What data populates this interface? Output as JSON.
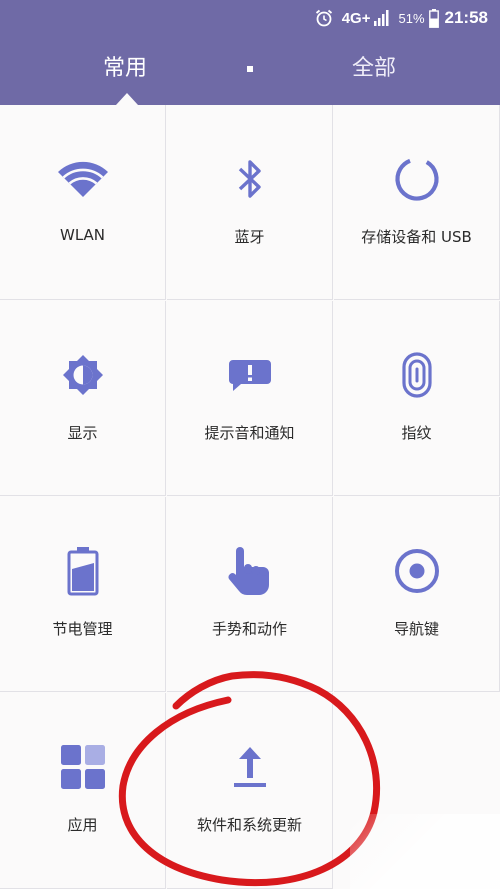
{
  "status_bar": {
    "network": "4G+",
    "battery_percent": "51%",
    "time": "21:58",
    "icons": [
      "alarm-icon",
      "signal-icon",
      "battery-icon"
    ]
  },
  "tabs": [
    {
      "label": "常用",
      "selected": true
    },
    {
      "label": "全部",
      "selected": false
    }
  ],
  "accent_color": "#6f6aa6",
  "icon_color": "#6b73cc",
  "settings": [
    {
      "label": "WLAN",
      "icon": "wifi-icon"
    },
    {
      "label": "蓝牙",
      "icon": "bluetooth-icon"
    },
    {
      "label": "存储设备和 USB",
      "icon": "storage-icon"
    },
    {
      "label": "显示",
      "icon": "display-brightness-icon"
    },
    {
      "label": "提示音和通知",
      "icon": "notification-icon"
    },
    {
      "label": "指纹",
      "icon": "fingerprint-icon"
    },
    {
      "label": "节电管理",
      "icon": "battery-saver-icon"
    },
    {
      "label": "手势和动作",
      "icon": "gesture-hand-icon"
    },
    {
      "label": "导航键",
      "icon": "navigation-key-icon"
    },
    {
      "label": "应用",
      "icon": "apps-grid-icon"
    },
    {
      "label": "软件和系统更新",
      "icon": "upload-arrow-icon"
    }
  ]
}
